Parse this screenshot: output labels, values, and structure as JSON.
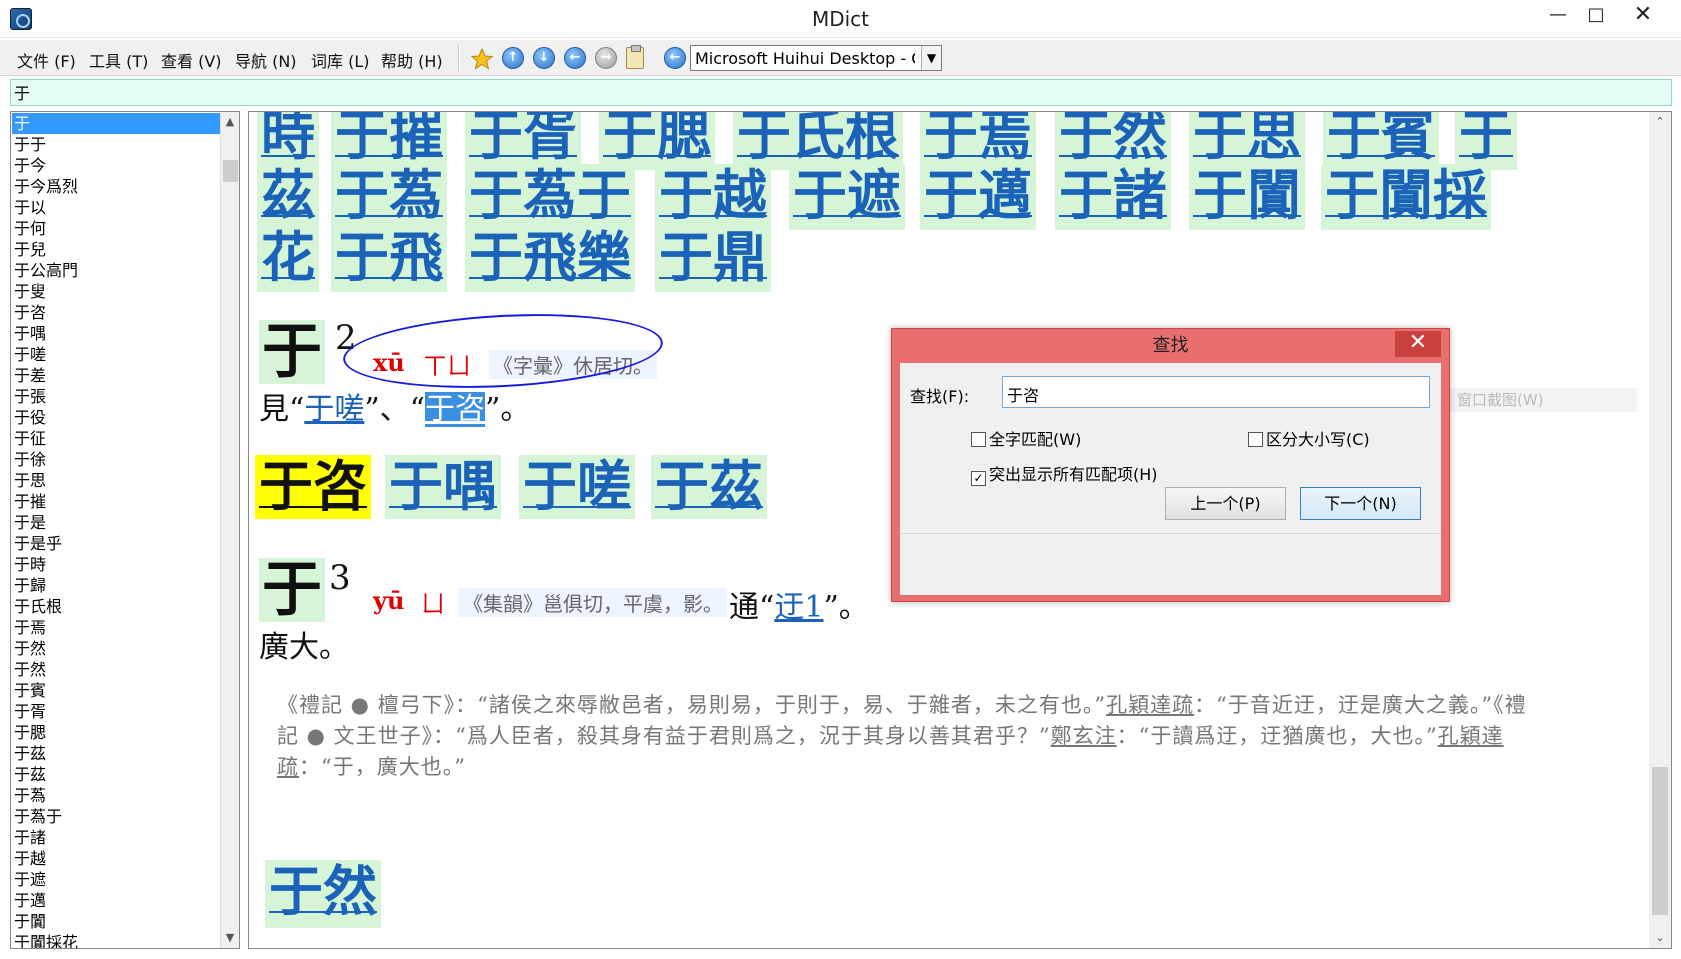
{
  "window": {
    "title": "MDict"
  },
  "menu": [
    "文件 (F)",
    "工具 (T)",
    "查看 (V)",
    "导航 (N)",
    "词库 (L)",
    "帮助 (H)"
  ],
  "toolbar": {
    "dictionary": "Microsoft Huihui Desktop - Chinese"
  },
  "search": {
    "value": "于"
  },
  "wordlist": {
    "items": [
      "于",
      "于于",
      "于今",
      "于今爲烈",
      "于以",
      "于何",
      "于兒",
      "于公高門",
      "于叟",
      "于咨",
      "于喁",
      "于嗟",
      "于差",
      "于張",
      "于役",
      "于征",
      "于徐",
      "于思",
      "于摧",
      "于是",
      "于是乎",
      "于時",
      "于歸",
      "于氏根",
      "于焉",
      "于然",
      "于然",
      "于賓",
      "于胥",
      "于腮",
      "于茲",
      "于茲",
      "于蒍",
      "于蒍于",
      "于諸",
      "于越",
      "于遮",
      "于邁",
      "于闐",
      "于闐採花"
    ],
    "selected": 0
  },
  "content": {
    "tiles_row1": [
      "時",
      "于摧",
      "于胥",
      "于腮",
      "于氏根",
      "于焉",
      "于然",
      "于思",
      "于賓",
      "于"
    ],
    "tiles_row2": [
      "茲",
      "于蒍",
      "于蒍于",
      "于越",
      "于遮",
      "于邁",
      "于諸",
      "于闐",
      "于闐採"
    ],
    "tiles_row3": [
      "花",
      "于飛",
      "于飛樂",
      "于鼎"
    ],
    "entry2": {
      "head": "于",
      "num": "2",
      "pinyin": "xū",
      "bopomofo": "ㄒㄩ",
      "fanqie": "《字彙》休居切。",
      "line_pre": "見“",
      "link1": "于嗟",
      "mid": "”、“",
      "link2": "于咨",
      "post": "”。"
    },
    "related": [
      "于咨",
      "于喁",
      "于嗟",
      "于茲"
    ],
    "entry3": {
      "head": "于",
      "num": "3",
      "pinyin": "yū",
      "bopomofo": "ㄩ",
      "fanqie": "《集韻》邕俱切，平虞，影。",
      "tong": "通“",
      "link": "迂1",
      "tong_end": "”。",
      "def": "廣大。"
    },
    "quote": {
      "p1": "《禮記 ● 檀弓下》：“諸侯之來辱敝邑者，易則易，于則于，易、于雜者，未之有也。”",
      "n1": "孔穎達疏",
      "p2": "：“于音近迂，迂是廣大之義。”《禮記 ● 文王世子》：“爲人臣者，殺其身有益于君則爲之，況于其身以善其君乎？”",
      "n2": "鄭玄注",
      "p3": "：“于讀爲迂，迂猶廣也，大也。”",
      "n3": "孔穎達疏",
      "p4": "：“于，廣大也。”"
    },
    "bottom_tile": "于然"
  },
  "find_dialog": {
    "title": "查找",
    "label": "查找(F):",
    "value": "于咨",
    "whole_word": "全字匹配(W)",
    "match_case": "区分大小写(C)",
    "highlight_all": "突出显示所有匹配项(H)",
    "prev": "上一个(P)",
    "next": "下一个(N)"
  },
  "ghost_menu": "窗口截图(W)"
}
